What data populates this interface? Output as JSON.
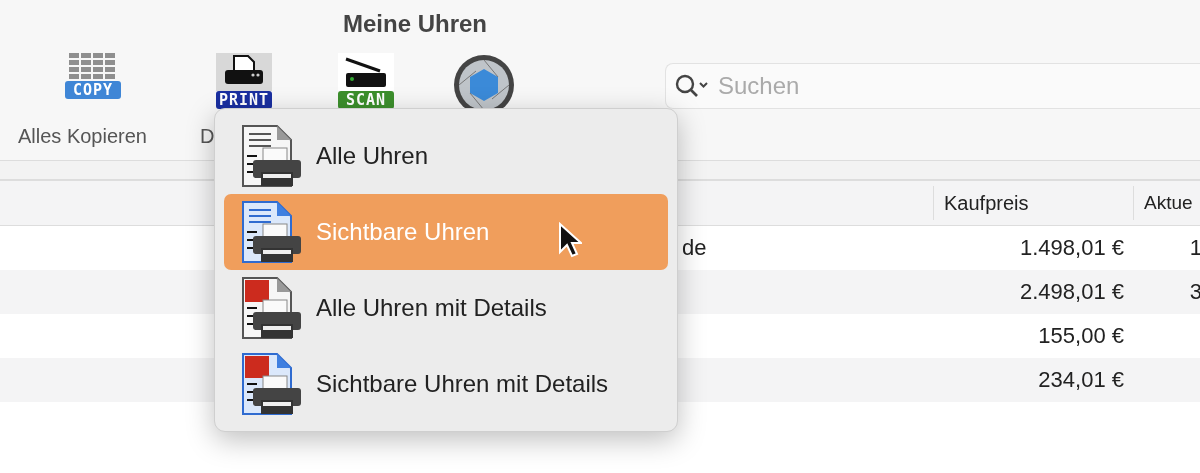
{
  "window": {
    "title": "Meine Uhren"
  },
  "toolbar": {
    "items": [
      {
        "kind": "copy",
        "badge": "COPY",
        "label": "Alles Kopieren"
      },
      {
        "kind": "print",
        "badge": "PRINT",
        "label": "D"
      },
      {
        "kind": "scan",
        "badge": "SCAN"
      },
      {
        "kind": "aperture"
      }
    ],
    "search": {
      "placeholder": "Suchen"
    }
  },
  "table": {
    "columns": [
      "Kaufpreis",
      "Aktue"
    ],
    "rows": [
      {
        "column_1": "de",
        "kaufpreis": "1.498,01 €",
        "column_3": "1"
      },
      {
        "kaufpreis": "2.498,01 €",
        "column_3": "3"
      },
      {
        "kaufpreis": "155,00 €"
      },
      {
        "kaufpreis": "234,01 €"
      }
    ]
  },
  "menu": {
    "items": [
      {
        "label": "Alle Uhren",
        "selected": false
      },
      {
        "label": "Sichtbare Uhren",
        "selected": true
      },
      {
        "label": "Alle Uhren mit Details",
        "selected": false
      },
      {
        "label": "Sichtbare Uhren mit Details",
        "selected": false
      }
    ]
  }
}
